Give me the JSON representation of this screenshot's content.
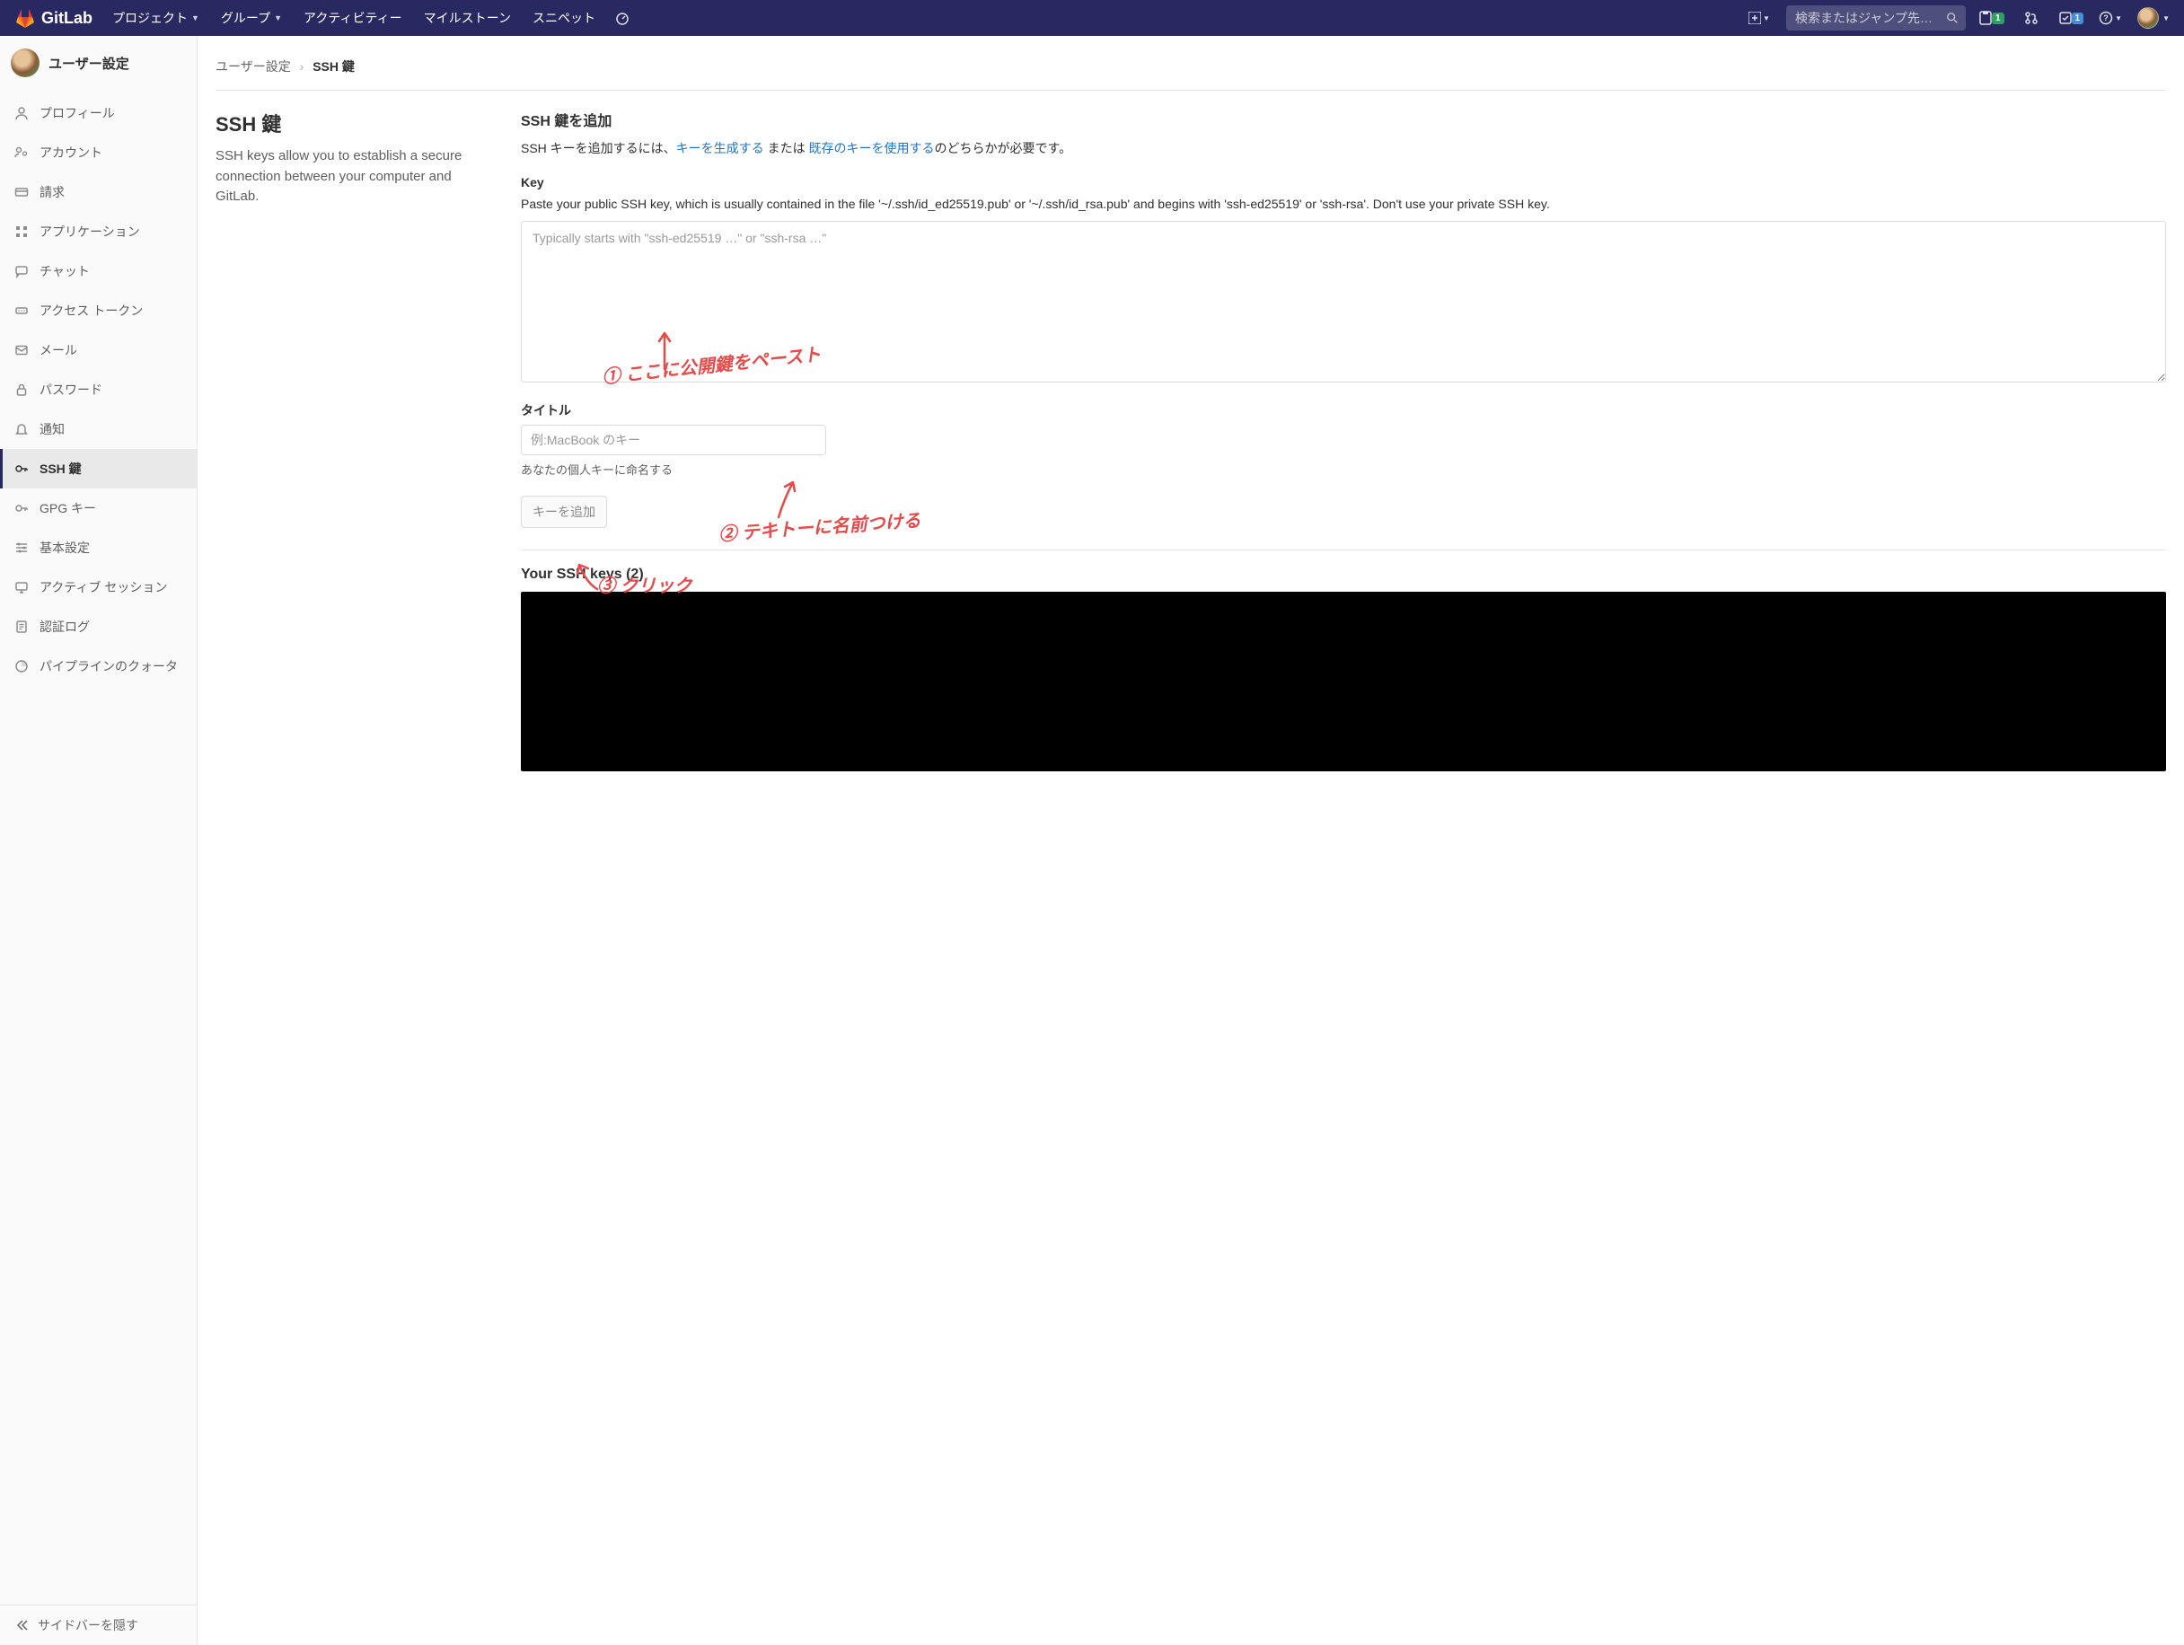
{
  "navbar": {
    "brand": "GitLab",
    "links": {
      "projects": "プロジェクト",
      "groups": "グループ",
      "activity": "アクティビティー",
      "milestones": "マイルストーン",
      "snippets": "スニペット"
    },
    "search_placeholder": "検索またはジャンプ先…",
    "issues_badge": "1",
    "todos_badge": "1"
  },
  "sidebar": {
    "title": "ユーザー設定",
    "items": [
      {
        "label": "プロフィール"
      },
      {
        "label": "アカウント"
      },
      {
        "label": "請求"
      },
      {
        "label": "アプリケーション"
      },
      {
        "label": "チャット"
      },
      {
        "label": "アクセス トークン"
      },
      {
        "label": "メール"
      },
      {
        "label": "パスワード"
      },
      {
        "label": "通知"
      },
      {
        "label": "SSH 鍵"
      },
      {
        "label": "GPG キー"
      },
      {
        "label": "基本設定"
      },
      {
        "label": "アクティブ セッション"
      },
      {
        "label": "認証ログ"
      },
      {
        "label": "パイプラインのクォータ"
      }
    ],
    "footer": "サイドバーを隠す"
  },
  "breadcrumb": {
    "root": "ユーザー設定",
    "current": "SSH 鍵"
  },
  "page": {
    "title": "SSH 鍵",
    "desc": "SSH keys allow you to establish a secure connection between your computer and GitLab."
  },
  "form": {
    "add_title": "SSH 鍵を追加",
    "add_help_prefix": "SSH キーを追加するには、",
    "add_link_generate": "キーを生成する",
    "add_help_mid": " または ",
    "add_link_existing": "既存のキーを使用する",
    "add_help_suffix": "のどちらかが必要です。",
    "key_label": "Key",
    "key_help": "Paste your public SSH key, which is usually contained in the file '~/.ssh/id_ed25519.pub' or '~/.ssh/id_rsa.pub' and begins with 'ssh-ed25519' or 'ssh-rsa'. Don't use your private SSH key.",
    "key_placeholder": "Typically starts with \"ssh-ed25519 …\" or \"ssh-rsa …\"",
    "title_label": "タイトル",
    "title_placeholder": "例:MacBook のキー",
    "title_help": "あなたの個人キーに命名する",
    "submit_label": "キーを追加",
    "your_keys_heading": "Your SSH keys (2)"
  },
  "annotations": {
    "a1": "① ここに公開鍵をペースト",
    "a2": "② テキトーに名前つける",
    "a3": "③ クリック"
  }
}
